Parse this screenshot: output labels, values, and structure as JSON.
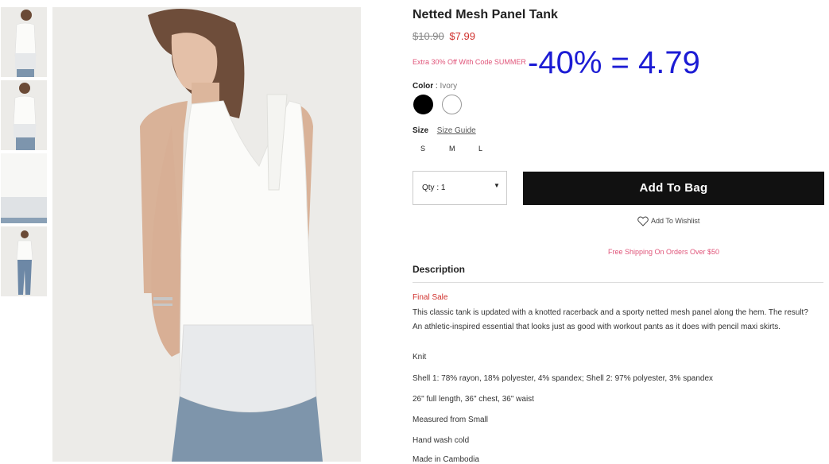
{
  "product": {
    "title": "Netted Mesh Panel Tank",
    "old_price": "$10.90",
    "new_price": "$7.99",
    "promo": "Extra 30% Off With Code SUMMER",
    "annotation": "-40% = 4.79"
  },
  "color": {
    "label": "Color",
    "separator": ":",
    "value": "Ivory",
    "swatches": [
      "#000000",
      "#ffffff"
    ]
  },
  "size": {
    "label": "Size",
    "guide": "Size Guide",
    "options": [
      "S",
      "M",
      "L"
    ]
  },
  "purchase": {
    "qty_label": "Qty : 1",
    "add_to_bag": "Add To Bag",
    "wishlist": "Add To Wishlist",
    "shipping": "Free Shipping On Orders Over $50"
  },
  "description": {
    "heading": "Description",
    "final_sale": "Final Sale",
    "body": "This classic tank is updated with a knotted racerback and a sporty netted mesh panel along the hem. The result? An athletic-inspired essential that looks just as good with workout pants as it does with pencil maxi skirts.",
    "specs": [
      "Knit",
      "Shell 1: 78% rayon, 18% polyester, 4% spandex; Shell 2: 97% polyester, 3% spandex",
      "26\" full length, 36\" chest, 36\" waist",
      "Measured from Small",
      "Hand wash cold",
      "Made in Cambodia"
    ]
  },
  "colors": {
    "sale_red": "#d0312d",
    "promo_pink": "#e0557a",
    "button_black": "#111111",
    "annotation_blue": "#1c1cd4"
  }
}
